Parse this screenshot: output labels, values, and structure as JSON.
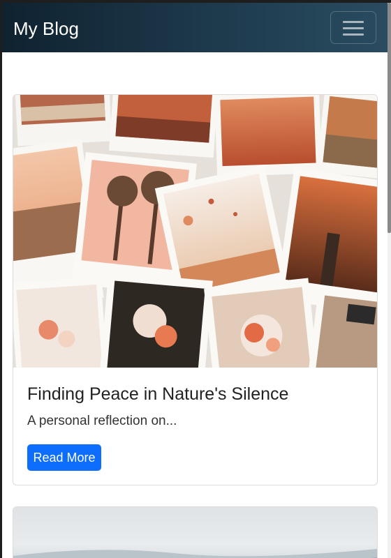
{
  "navbar": {
    "brand": "My Blog",
    "menu_icon": "hamburger-menu-icon"
  },
  "posts": [
    {
      "image": "polaroid-photos-collage",
      "title": "Finding Peace in Nature's Silence",
      "excerpt": "A personal reflection on...",
      "button_label": "Read More"
    },
    {
      "image": "misty-landscape-photo"
    }
  ],
  "colors": {
    "navbar_start": "#0f2230",
    "navbar_end": "#2a4c60",
    "button": "#0d6efd"
  }
}
